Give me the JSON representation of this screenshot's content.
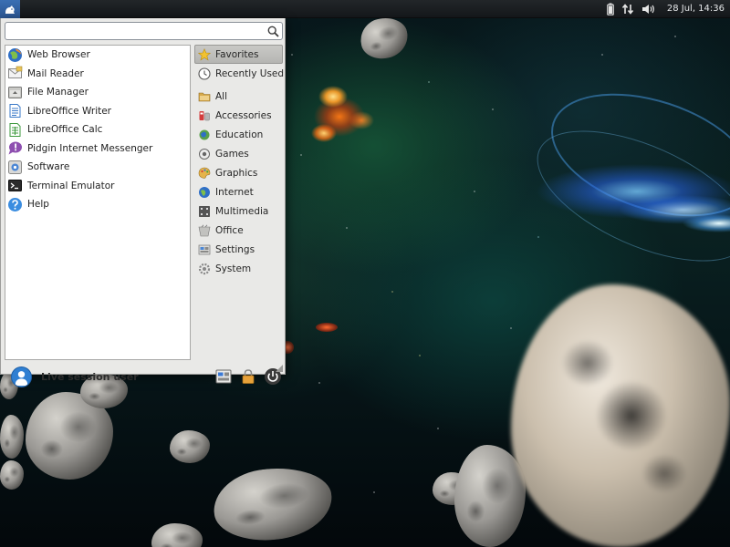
{
  "panel": {
    "clock": "28 Jul, 14:36",
    "whisker_icon": "xubuntu-mouse-icon",
    "tray_icons": [
      "battery-icon",
      "network-transfer-icon",
      "volume-icon"
    ]
  },
  "menu": {
    "search": {
      "value": "",
      "placeholder": ""
    },
    "favorites": [
      {
        "label": "Web Browser",
        "icon": "web-browser-icon"
      },
      {
        "label": "Mail Reader",
        "icon": "mail-reader-icon"
      },
      {
        "label": "File Manager",
        "icon": "file-manager-icon"
      },
      {
        "label": "LibreOffice Writer",
        "icon": "writer-icon"
      },
      {
        "label": "LibreOffice Calc",
        "icon": "calc-icon"
      },
      {
        "label": "Pidgin Internet Messenger",
        "icon": "pidgin-icon"
      },
      {
        "label": "Software",
        "icon": "software-icon"
      },
      {
        "label": "Terminal Emulator",
        "icon": "terminal-icon"
      },
      {
        "label": "Help",
        "icon": "help-icon"
      }
    ],
    "categories": [
      {
        "label": "Favorites",
        "icon": "star-icon",
        "active": true
      },
      {
        "label": "Recently Used",
        "icon": "clock-icon"
      },
      {
        "label": "All",
        "icon": "folder-icon"
      },
      {
        "label": "Accessories",
        "icon": "accessories-icon"
      },
      {
        "label": "Education",
        "icon": "education-icon"
      },
      {
        "label": "Games",
        "icon": "games-icon"
      },
      {
        "label": "Graphics",
        "icon": "graphics-icon"
      },
      {
        "label": "Internet",
        "icon": "internet-icon"
      },
      {
        "label": "Multimedia",
        "icon": "multimedia-icon"
      },
      {
        "label": "Office",
        "icon": "office-icon"
      },
      {
        "label": "Settings",
        "icon": "settings-icon"
      },
      {
        "label": "System",
        "icon": "system-icon"
      }
    ],
    "user": {
      "name": "Live session user"
    },
    "actions": [
      "settings-manager-icon",
      "lock-icon",
      "power-icon"
    ],
    "colors": {
      "panel": "#1b1e21",
      "menu_bg": "#e9e9e7",
      "selected": "#bfbfbc",
      "accent": "#2f7fd2"
    }
  }
}
